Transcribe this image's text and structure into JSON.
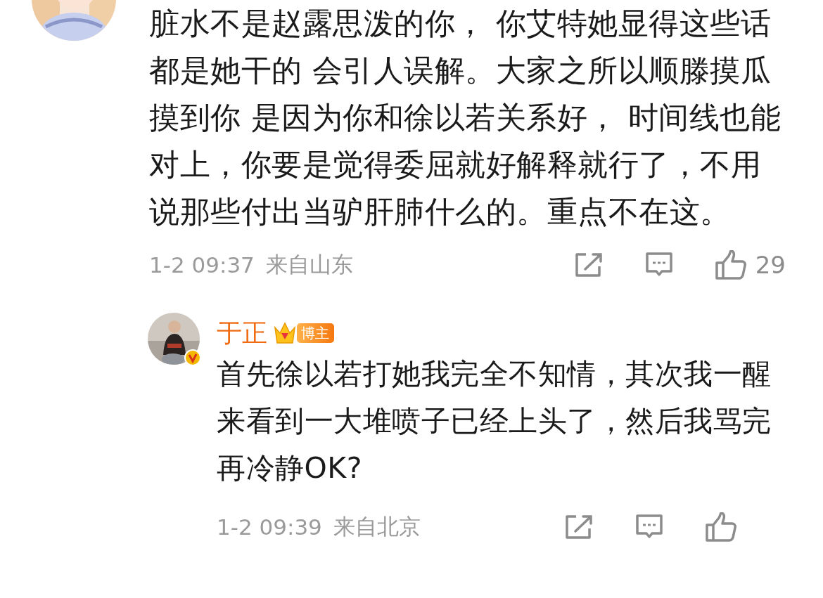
{
  "comments": [
    {
      "avatar": {
        "kind": "picture"
      },
      "text": "脏水不是赵露思泼的你， 你艾特她显得这些话都是她干的 会引人误解。大家之所以顺滕摸瓜摸到你 是因为你和徐以若关系好， 时间线也能对上，你要是觉得委屈就好解释就行了，不用说那些付出当驴肝肺什么的。重点不在这。",
      "time": "1-2 09:37",
      "location": "来自山东",
      "likes": "29"
    },
    {
      "avatar": {
        "kind": "picture",
        "verified": true
      },
      "name": "于正",
      "badge": "博主",
      "text": "首先徐以若打她我完全不知情，其次我一醒来看到一大堆喷子已经上头了，然后我骂完再冷静OK?",
      "time": "1-2 09:39",
      "location": "来自北京"
    }
  ]
}
